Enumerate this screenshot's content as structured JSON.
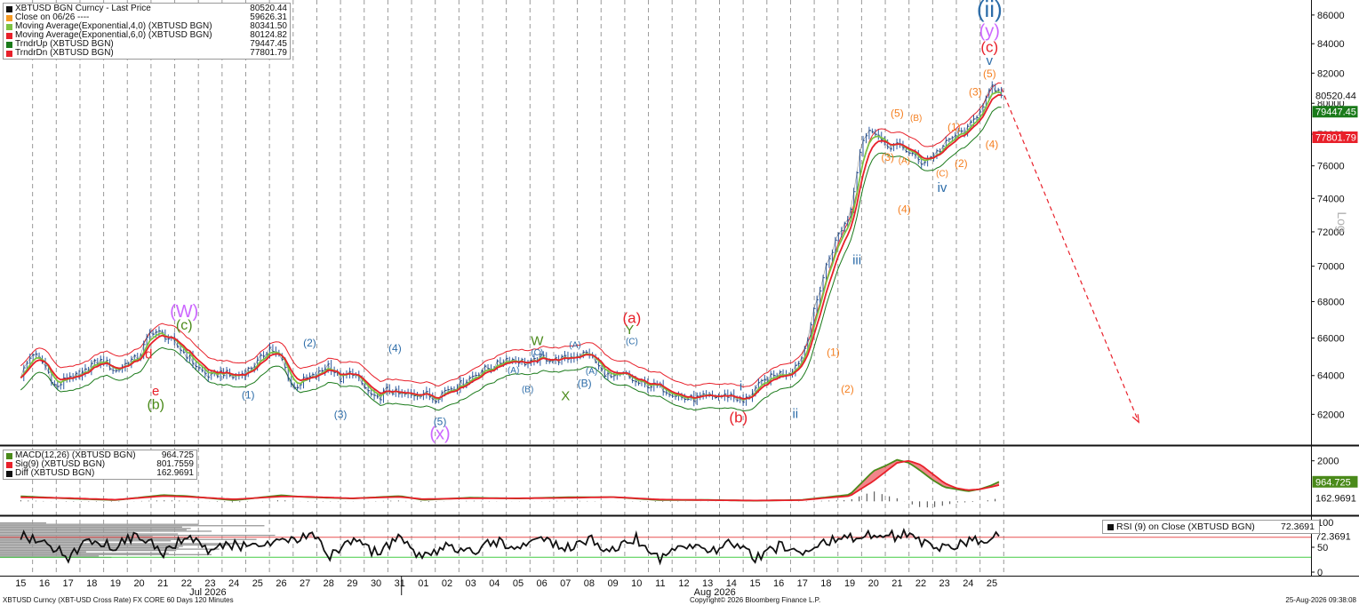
{
  "chart_data": [
    {
      "type": "line",
      "panel": "price",
      "legend": [
        {
          "label": "XBTUSD BGN Curncy - Last Price",
          "value": "80520.44",
          "color": "#111111"
        },
        {
          "label": "Close on 06/26 ----",
          "value": "59626.31",
          "color": "#f59a23"
        },
        {
          "label": "Moving Average(Exponential,4,0) (XBTUSD BGN)",
          "value": "80341.50",
          "color": "#7cc242"
        },
        {
          "label": "Moving Average(Exponential,6,0) (XBTUSD BGN)",
          "value": "80124.82",
          "color": "#e8202a"
        },
        {
          "label": "TrndrUp (XBTUSD BGN)",
          "value": "79447.45",
          "color": "#1a7a1a"
        },
        {
          "label": "TrndrDn (XBTUSD BGN)",
          "value": "77801.79",
          "color": "#e8202a"
        }
      ],
      "ylabel": "Log",
      "y_ticks": [
        "62000",
        "64000",
        "66000",
        "68000",
        "70000",
        "72000",
        "74000",
        "76000",
        "78000",
        "80000",
        "82000",
        "84000",
        "86000"
      ],
      "y_range": [
        60500,
        87000
      ],
      "y_scale": "log",
      "last_value_tags": [
        {
          "text": "80520.44",
          "value": 80520.44,
          "bg": "#ffffff",
          "fg": "#111111"
        },
        {
          "text": "79447.45",
          "value": 79447.45,
          "bg": "#1a7a1a",
          "fg": "#ffffff"
        },
        {
          "text": "77801.79",
          "value": 77801.79,
          "bg": "#e8202a",
          "fg": "#ffffff"
        }
      ],
      "price_path_days": [
        0,
        0.5,
        1,
        1.5,
        2,
        2.5,
        3,
        3.5,
        4,
        4.5,
        5,
        5.5,
        6,
        6.5,
        7,
        7.5,
        8,
        8.5,
        9,
        9.5,
        10,
        10.5,
        11,
        11.5,
        12,
        12.5,
        13,
        13.5,
        14,
        14.5,
        15,
        15.5,
        16,
        16.5,
        17,
        17.5,
        18,
        18.5,
        19,
        19.5,
        20,
        20.5,
        21,
        21.5,
        22,
        22.5,
        23,
        23.5,
        24,
        24.5,
        25,
        25.5,
        26,
        26.5,
        27,
        27.5,
        28,
        28.5,
        29,
        29.5,
        30,
        30.5,
        31,
        31.5,
        32,
        32.5,
        33,
        33.5,
        34,
        34.5,
        35,
        35.5,
        36,
        36.5,
        37,
        37.5,
        38,
        38.5,
        39,
        39.5,
        40,
        40.5,
        41,
        41.5
      ],
      "price_path_values": [
        64000,
        65200,
        64600,
        63300,
        64000,
        63900,
        64600,
        64800,
        64200,
        64700,
        65000,
        66400,
        66200,
        65700,
        65100,
        64400,
        63900,
        64200,
        63900,
        64200,
        64700,
        65500,
        64900,
        63300,
        63800,
        64000,
        64600,
        63800,
        64200,
        63400,
        62700,
        63300,
        63000,
        63000,
        63100,
        62800,
        63300,
        63500,
        63900,
        64300,
        64500,
        64900,
        64800,
        64600,
        65000,
        64800,
        64900,
        65100,
        65200,
        64300,
        63800,
        64100,
        63600,
        63500,
        63400,
        63100,
        62800,
        62800,
        62900,
        62900,
        63000,
        62600,
        63300,
        63800,
        64100,
        64200,
        65000,
        67500,
        70000,
        71800,
        73000,
        77600,
        78400,
        77200,
        77300,
        76900,
        76200,
        76600,
        77300,
        78000,
        78300,
        79600,
        81000,
        80520.44
      ],
      "wave_labels": [
        {
          "text": "(W)",
          "day": 6.9,
          "value": 67400,
          "color": "#cc66ff",
          "size": 20
        },
        {
          "text": "(c)",
          "day": 6.9,
          "value": 66650,
          "color": "#4a8a1a",
          "size": 16
        },
        {
          "text": "d",
          "day": 5.4,
          "value": 65100,
          "color": "#e8202a",
          "size": 15
        },
        {
          "text": "e",
          "day": 5.7,
          "value": 63150,
          "color": "#e8202a",
          "size": 15
        },
        {
          "text": "(b)",
          "day": 5.7,
          "value": 62450,
          "color": "#4a8a1a",
          "size": 16
        },
        {
          "text": "(1)",
          "day": 9.6,
          "value": 62950,
          "color": "#2c6ca8",
          "size": 12
        },
        {
          "text": "(2)",
          "day": 12.2,
          "value": 65700,
          "color": "#2c6ca8",
          "size": 12
        },
        {
          "text": "(3)",
          "day": 13.5,
          "value": 61950,
          "color": "#2c6ca8",
          "size": 12
        },
        {
          "text": "(4)",
          "day": 15.8,
          "value": 65400,
          "color": "#2c6ca8",
          "size": 12
        },
        {
          "text": "(5)",
          "day": 17.7,
          "value": 61600,
          "color": "#2c6ca8",
          "size": 12
        },
        {
          "text": "(x)",
          "day": 17.7,
          "value": 60980,
          "color": "#cc66ff",
          "size": 20
        },
        {
          "text": "(A)",
          "day": 20.8,
          "value": 64250,
          "color": "#2c6ca8",
          "size": 10
        },
        {
          "text": "(B)",
          "day": 21.4,
          "value": 63250,
          "color": "#2c6ca8",
          "size": 10
        },
        {
          "text": "(C)",
          "day": 21.8,
          "value": 65200,
          "color": "#2c6ca8",
          "size": 10
        },
        {
          "text": "W",
          "day": 21.8,
          "value": 65800,
          "color": "#4a8a1a",
          "size": 15
        },
        {
          "text": "X",
          "day": 23.0,
          "value": 62900,
          "color": "#4a8a1a",
          "size": 15
        },
        {
          "text": "(A)",
          "day": 23.4,
          "value": 65600,
          "color": "#2c6ca8",
          "size": 10
        },
        {
          "text": "(A)",
          "day": 24.1,
          "value": 64200,
          "color": "#2c6ca8",
          "size": 10
        },
        {
          "text": "(B)",
          "day": 23.8,
          "value": 63550,
          "color": "#2c6ca8",
          "size": 12
        },
        {
          "text": "(C)",
          "day": 25.8,
          "value": 65800,
          "color": "#2c6ca8",
          "size": 10
        },
        {
          "text": "Y",
          "day": 25.7,
          "value": 66400,
          "color": "#4a8a1a",
          "size": 15
        },
        {
          "text": "(a)",
          "day": 25.8,
          "value": 67050,
          "color": "#e8202a",
          "size": 17
        },
        {
          "text": "i",
          "day": 30.4,
          "value": 63400,
          "color": "#2c6ca8",
          "size": 15
        },
        {
          "text": "(b)",
          "day": 30.3,
          "value": 61800,
          "color": "#e8202a",
          "size": 17
        },
        {
          "text": "ii",
          "day": 32.7,
          "value": 62000,
          "color": "#2c6ca8",
          "size": 15
        },
        {
          "text": "(1)",
          "day": 34.3,
          "value": 65200,
          "color": "#f57f20",
          "size": 12
        },
        {
          "text": "(2)",
          "day": 34.9,
          "value": 63250,
          "color": "#f57f20",
          "size": 12
        },
        {
          "text": "iii",
          "day": 35.3,
          "value": 70300,
          "color": "#2c6ca8",
          "size": 15
        },
        {
          "text": "(3)",
          "day": 36.6,
          "value": 76500,
          "color": "#f57f20",
          "size": 12
        },
        {
          "text": "(A)",
          "day": 37.3,
          "value": 76300,
          "color": "#f57f20",
          "size": 10
        },
        {
          "text": "(4)",
          "day": 37.3,
          "value": 73300,
          "color": "#f57f20",
          "size": 12
        },
        {
          "text": "(5)",
          "day": 37.0,
          "value": 79300,
          "color": "#f57f20",
          "size": 12
        },
        {
          "text": "(B)",
          "day": 37.8,
          "value": 79000,
          "color": "#f57f20",
          "size": 10
        },
        {
          "text": "(C)",
          "day": 38.9,
          "value": 75500,
          "color": "#f57f20",
          "size": 10
        },
        {
          "text": "iv",
          "day": 38.9,
          "value": 74600,
          "color": "#2c6ca8",
          "size": 15
        },
        {
          "text": "(1)",
          "day": 39.4,
          "value": 78400,
          "color": "#f57f20",
          "size": 12
        },
        {
          "text": "(2)",
          "day": 39.7,
          "value": 76100,
          "color": "#f57f20",
          "size": 12
        },
        {
          "text": "(3)",
          "day": 40.3,
          "value": 80700,
          "color": "#f57f20",
          "size": 12
        },
        {
          "text": "(4)",
          "day": 41.0,
          "value": 77300,
          "color": "#f57f20",
          "size": 12
        },
        {
          "text": "(5)",
          "day": 40.9,
          "value": 81900,
          "color": "#f57f20",
          "size": 12
        },
        {
          "text": "v",
          "day": 40.9,
          "value": 82800,
          "color": "#2c6ca8",
          "size": 15
        },
        {
          "text": "(c)",
          "day": 40.9,
          "value": 83700,
          "color": "#e8202a",
          "size": 17
        },
        {
          "text": "(y)",
          "day": 40.9,
          "value": 84800,
          "color": "#cc66ff",
          "size": 20
        },
        {
          "text": "(ii)",
          "day": 40.9,
          "value": 86300,
          "color": "#2c6ca8",
          "size": 26
        }
      ],
      "projection": {
        "from_day": 41.4,
        "from_value": 81000,
        "to_day": 47.2,
        "to_value": 61600,
        "color": "#e8202a"
      }
    },
    {
      "type": "line",
      "panel": "macd",
      "legend": [
        {
          "label": "MACD(12,26) (XBTUSD BGN)",
          "value": "964.725",
          "color": "#4a8a1a"
        },
        {
          "label": "Sig(9) (XBTUSD BGN)",
          "value": "801.7559",
          "color": "#e8202a"
        },
        {
          "label": "Diff (XBTUSD BGN)",
          "value": "162.9691",
          "color": "#111111"
        }
      ],
      "y_ticks": [
        "2000"
      ],
      "y_range": [
        -600,
        2600
      ],
      "last_value_tags": [
        {
          "text": "964.725",
          "value": 964.725,
          "bg": "#4a8a1a",
          "fg": "#ffffff"
        },
        {
          "text": "162.9691",
          "value": 162.9691,
          "bg": "#ffffff",
          "fg": "#111111"
        }
      ],
      "days": [
        0,
        2,
        4,
        6,
        7,
        9,
        11,
        12,
        14,
        16,
        17,
        19,
        21,
        23,
        25,
        27,
        29,
        31,
        33,
        34,
        35,
        36,
        36.5,
        37,
        37.5,
        38,
        38.5,
        39,
        39.5,
        40,
        40.5,
        41,
        41.3
      ],
      "macd": [
        250,
        140,
        60,
        310,
        260,
        50,
        300,
        210,
        140,
        260,
        70,
        180,
        140,
        200,
        210,
        60,
        70,
        30,
        70,
        200,
        330,
        1500,
        1750,
        2050,
        1900,
        1500,
        1050,
        700,
        600,
        500,
        600,
        800,
        964.725
      ],
      "signal": [
        200,
        160,
        80,
        260,
        230,
        100,
        240,
        230,
        150,
        220,
        110,
        150,
        150,
        170,
        210,
        90,
        60,
        40,
        60,
        170,
        260,
        1000,
        1450,
        1900,
        2000,
        1800,
        1350,
        900,
        650,
        550,
        600,
        720,
        801.7559
      ]
    },
    {
      "type": "line",
      "panel": "rsi",
      "legend": [
        {
          "label": "RSI (9)  on Close (XBTUSD BGN)",
          "value": "72.3691",
          "color": "#111111"
        }
      ],
      "y_ticks": [
        "0",
        "50",
        "100"
      ],
      "y_range": [
        0,
        100
      ],
      "levels": [
        70,
        30
      ],
      "last_value_tags": [
        {
          "text": "72.3691",
          "value": 72.3691,
          "bg": "#ffffff",
          "fg": "#111111"
        }
      ],
      "days": [
        0,
        1,
        2,
        3,
        4,
        5,
        6,
        7,
        8,
        9,
        10,
        11,
        12,
        12.6,
        13,
        14,
        15,
        16,
        17,
        18,
        19,
        20,
        21,
        22,
        23,
        24,
        25,
        26,
        27,
        28,
        29,
        30,
        31,
        32,
        33,
        34,
        35,
        36,
        37,
        37.5,
        38,
        39,
        40,
        40.6,
        41,
        41.3
      ],
      "values": [
        72,
        60,
        30,
        66,
        52,
        76,
        38,
        70,
        42,
        55,
        48,
        60,
        72,
        75,
        30,
        60,
        40,
        68,
        28,
        58,
        40,
        64,
        48,
        72,
        45,
        66,
        40,
        68,
        26,
        52,
        40,
        58,
        28,
        52,
        40,
        62,
        68,
        80,
        72,
        78,
        58,
        45,
        60,
        65,
        75,
        72.3691
      ]
    }
  ],
  "x_axis": {
    "day_labels": [
      "15",
      "16",
      "17",
      "18",
      "19",
      "20",
      "21",
      "22",
      "23",
      "24",
      "25",
      "26",
      "27",
      "28",
      "29",
      "30",
      "31",
      "01",
      "02",
      "03",
      "04",
      "05",
      "06",
      "07",
      "08",
      "09",
      "10",
      "11",
      "12",
      "13",
      "14",
      "15",
      "16",
      "17",
      "18",
      "19",
      "20",
      "21",
      "22",
      "23",
      "24",
      "25"
    ],
    "months": [
      {
        "text": "Jul 2026",
        "day": 7.9
      },
      {
        "text": "Aug 2026",
        "day": 29.3
      }
    ],
    "month_divider_day": 16.5
  },
  "footer": {
    "left": "XBTUSD Curncy (XBT-USD Cross Rate) FX CORE 60 Days 120 Minutes",
    "center": "Copyright© 2026 Bloomberg Finance L.P.",
    "right": "25-Aug-2026 09:38:08"
  }
}
